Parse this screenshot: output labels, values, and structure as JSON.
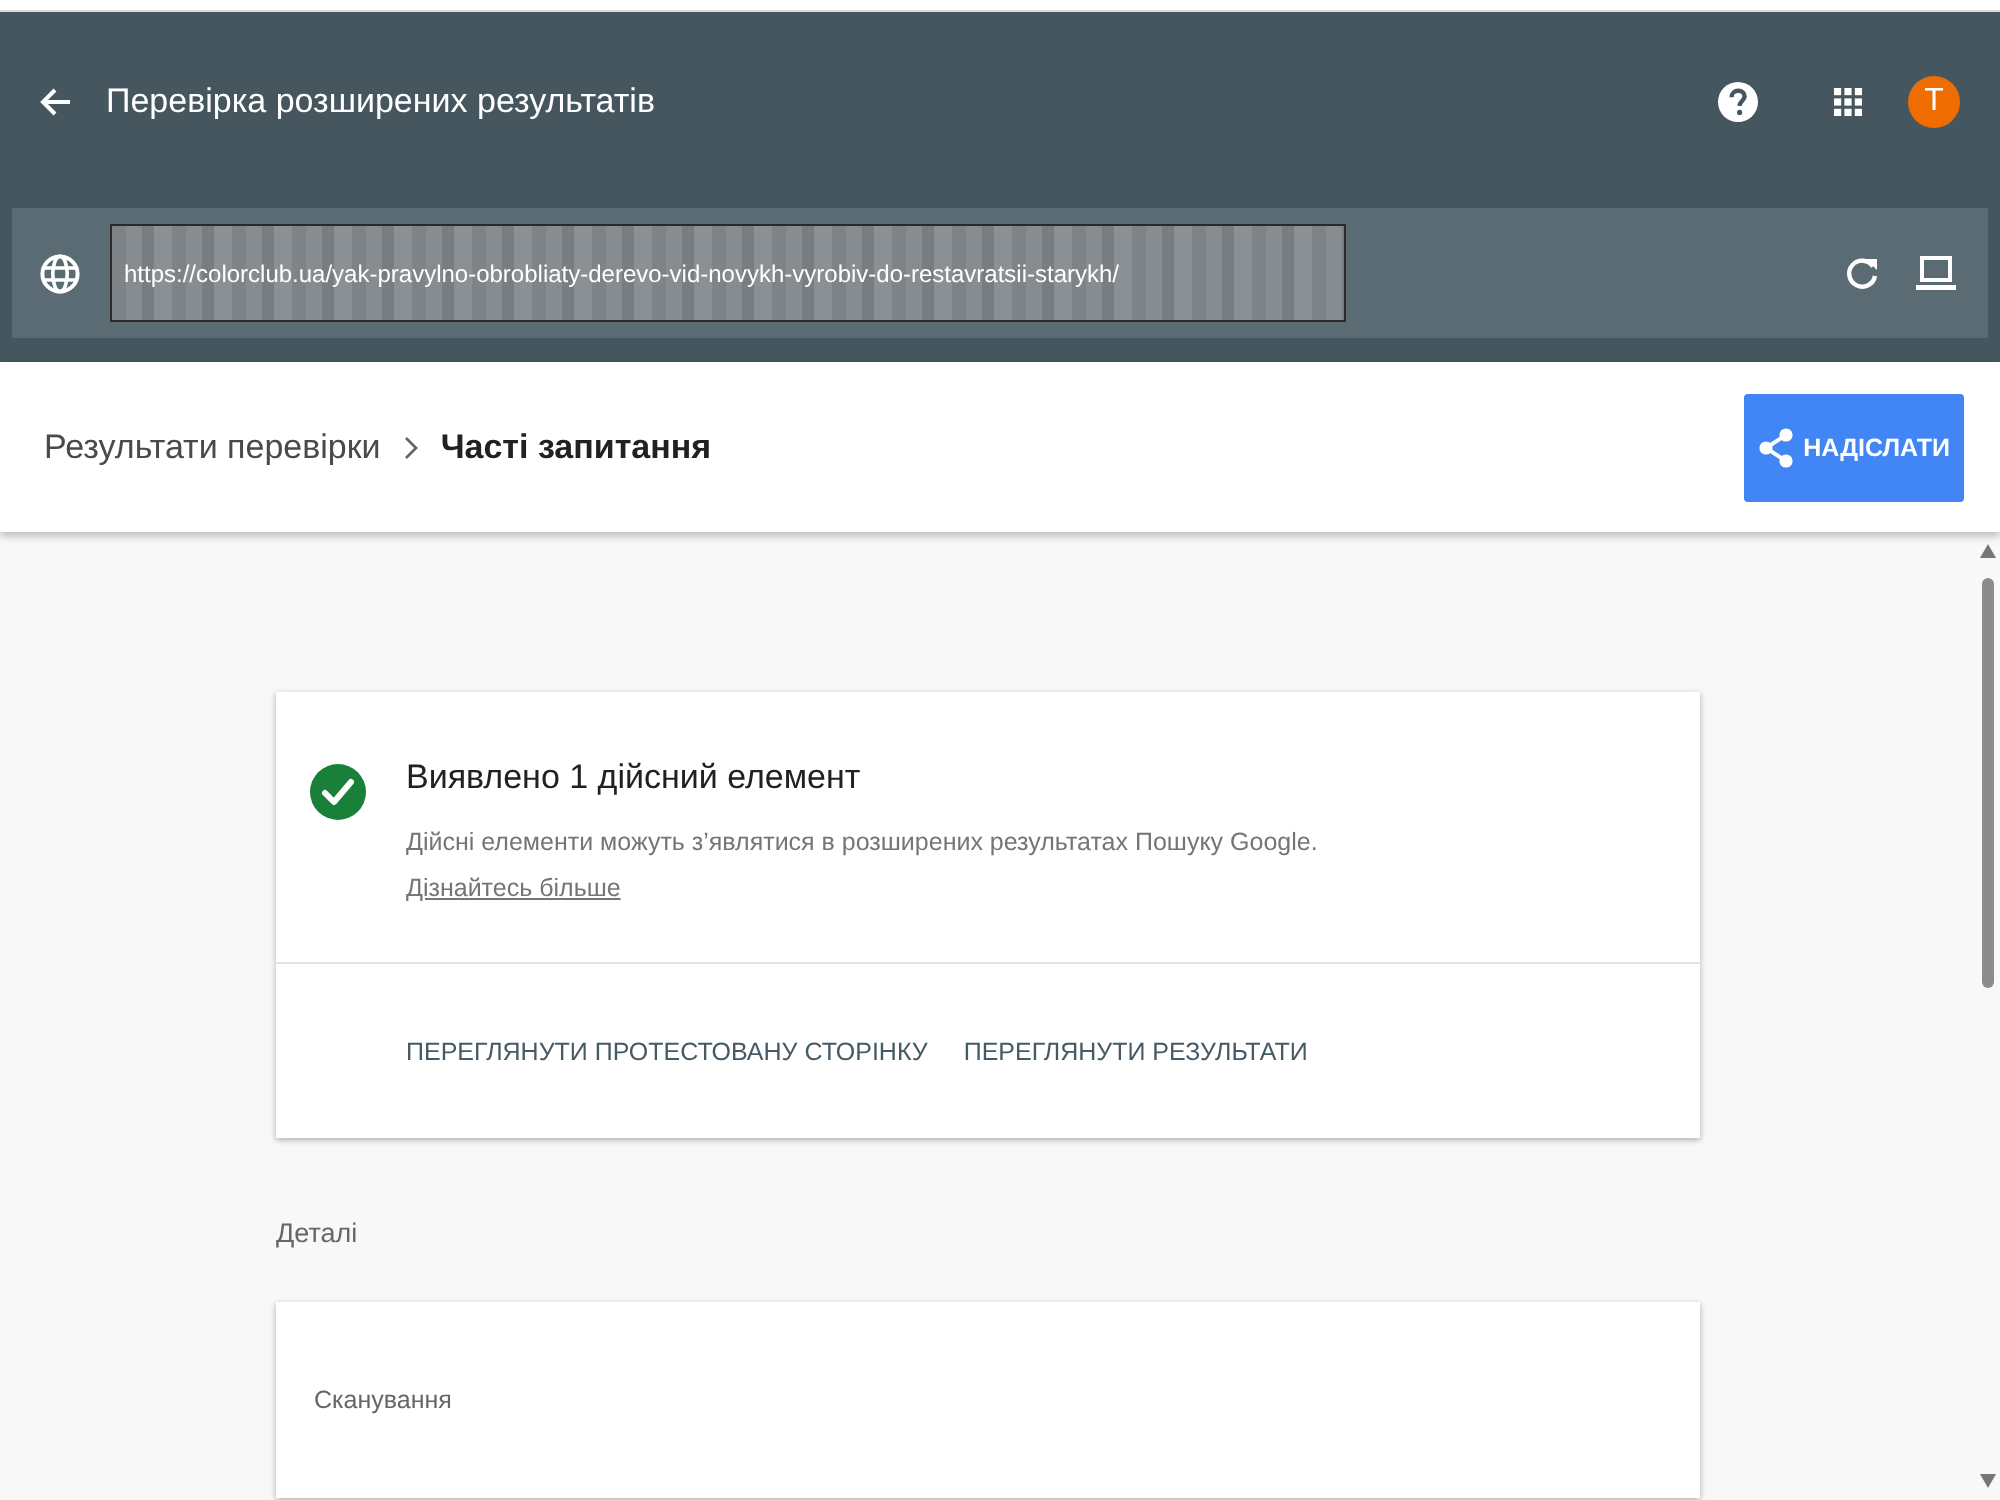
{
  "header": {
    "title": "Перевірка розширених результатів",
    "avatar_letter": "T"
  },
  "url_bar": {
    "value": "https://colorclub.ua/yak-pravylno-obrobliaty-derevo-vid-novykh-vyrobiv-do-restavratsii-starykh/"
  },
  "breadcrumb": {
    "items": [
      {
        "label": "Результати перевірки",
        "selected": false
      },
      {
        "label": "Часті запитання",
        "selected": true
      }
    ],
    "share_button": "НАДІСЛАТИ"
  },
  "result_card": {
    "valid": true,
    "title": "Виявлено 1 дійсний елемент",
    "description": "Дійсні елементи можуть з’являтися в розширених результатах Пошуку Google.",
    "link": "Дізнайтесь більше",
    "actions": [
      "ПЕРЕГЛЯНУТИ ПРОТЕСТОВАНУ СТОРІНКУ",
      "ПЕРЕГЛЯНУТИ РЕЗУЛЬТАТИ"
    ]
  },
  "details": {
    "heading": "Деталі",
    "sections": [
      {
        "title": "Сканування"
      }
    ]
  }
}
